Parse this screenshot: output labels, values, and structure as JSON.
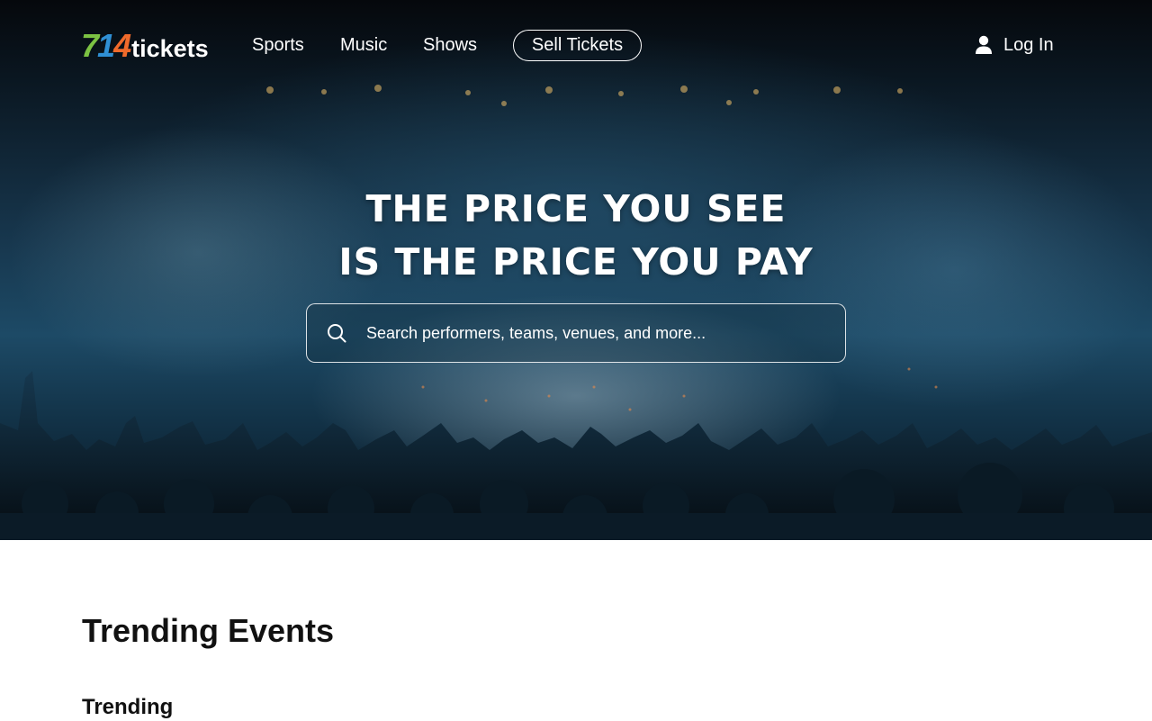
{
  "brand": {
    "digit_7": "7",
    "digit_1": "1",
    "digit_4": "4",
    "word": "tickets",
    "colors": {
      "seven": "#7cc243",
      "one": "#2f8fd4",
      "four": "#f06a2b"
    }
  },
  "nav": {
    "links": [
      {
        "label": "Sports"
      },
      {
        "label": "Music"
      },
      {
        "label": "Shows"
      }
    ],
    "sell_label": "Sell Tickets",
    "login_label": "Log In",
    "login_icon": "user-icon"
  },
  "hero": {
    "headline_line1": "THE PRICE YOU SEE",
    "headline_line2": "IS THE PRICE YOU PAY",
    "search_placeholder": "Search performers, teams, venues, and more...",
    "search_value": "",
    "search_icon": "search-icon",
    "background": "concert crowd"
  },
  "main": {
    "section_title": "Trending Events",
    "sub_title": "Trending"
  }
}
